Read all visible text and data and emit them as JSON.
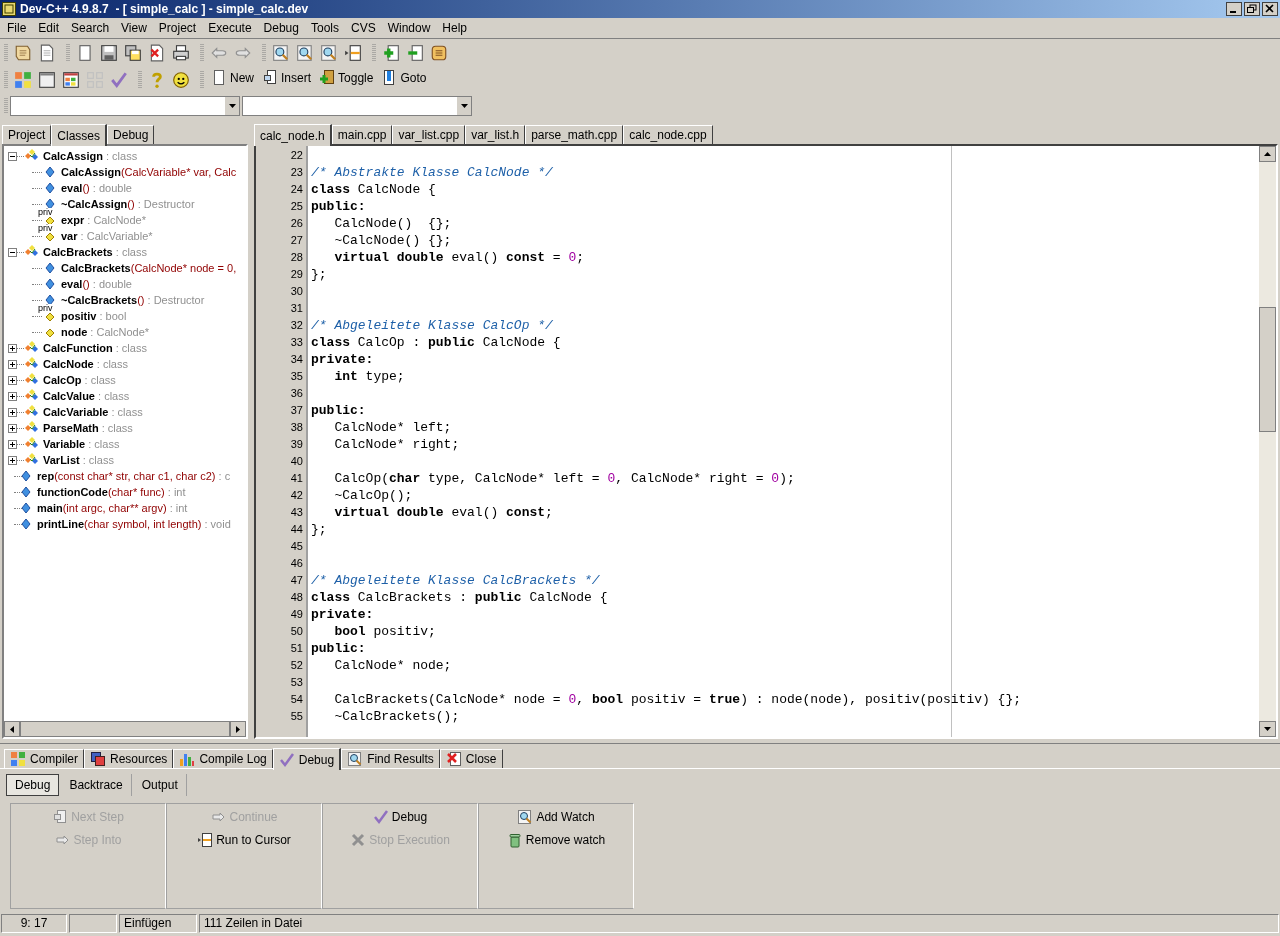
{
  "window": {
    "title": "Dev-C++ 4.9.8.7  - [ simple_calc ] - simple_calc.dev"
  },
  "menu": [
    "File",
    "Edit",
    "Search",
    "View",
    "Project",
    "Execute",
    "Debug",
    "Tools",
    "CVS",
    "Window",
    "Help"
  ],
  "bookmark_buttons": [
    "New",
    "Insert",
    "Toggle",
    "Goto"
  ],
  "left_tabs": [
    {
      "label": "Project",
      "selected": false
    },
    {
      "label": "Classes",
      "selected": true
    },
    {
      "label": "Debug",
      "selected": false
    }
  ],
  "class_tree": [
    {
      "kind": "class",
      "name": "CalcAssign",
      "type": ": class",
      "expanded": true,
      "children": [
        {
          "kind": "method",
          "name": "CalcAssign",
          "params": "(CalcVariable* var, Calc"
        },
        {
          "kind": "method",
          "name": "eval",
          "params": "()",
          "type": ": double"
        },
        {
          "kind": "method",
          "name": "~CalcAssign",
          "params": "()",
          "type": ": Destructor"
        },
        {
          "kind": "variable",
          "badge": "priv",
          "name": "expr",
          "type": ": CalcNode*"
        },
        {
          "kind": "variable",
          "badge": "priv",
          "name": "var",
          "type": ": CalcVariable*"
        }
      ]
    },
    {
      "kind": "class",
      "name": "CalcBrackets",
      "type": ": class",
      "expanded": true,
      "children": [
        {
          "kind": "method",
          "name": "CalcBrackets",
          "params": "(CalcNode* node = 0,"
        },
        {
          "kind": "method",
          "name": "eval",
          "params": "()",
          "type": ": double"
        },
        {
          "kind": "method",
          "name": "~CalcBrackets",
          "params": "()",
          "type": ": Destructor"
        },
        {
          "kind": "variable",
          "badge": "priv",
          "name": "positiv",
          "type": ": bool"
        },
        {
          "kind": "variable",
          "name": "node",
          "type": ": CalcNode*"
        }
      ]
    },
    {
      "kind": "class",
      "name": "CalcFunction",
      "type": ": class",
      "expanded": false
    },
    {
      "kind": "class",
      "name": "CalcNode",
      "type": ": class",
      "expanded": false
    },
    {
      "kind": "class",
      "name": "CalcOp",
      "type": ": class",
      "expanded": false
    },
    {
      "kind": "class",
      "name": "CalcValue",
      "type": ": class",
      "expanded": false
    },
    {
      "kind": "class",
      "name": "CalcVariable",
      "type": ": class",
      "expanded": false
    },
    {
      "kind": "class",
      "name": "ParseMath",
      "type": ": class",
      "expanded": false
    },
    {
      "kind": "class",
      "name": "Variable",
      "type": ": class",
      "expanded": false
    },
    {
      "kind": "class",
      "name": "VarList",
      "type": ": class",
      "expanded": false
    },
    {
      "kind": "function",
      "name": "rep",
      "params": "(const char* str, char c1, char c2)",
      "type": ": c"
    },
    {
      "kind": "function",
      "name": "functionCode",
      "params": "(char* func)",
      "type": ": int"
    },
    {
      "kind": "function",
      "name": "main",
      "params": "(int argc, char** argv)",
      "type": ": int"
    },
    {
      "kind": "function",
      "name": "printLine",
      "params": "(char symbol, int length)",
      "type": ": void"
    }
  ],
  "editor_tabs": [
    {
      "label": "calc_node.h",
      "selected": true
    },
    {
      "label": "main.cpp",
      "selected": false
    },
    {
      "label": "var_list.cpp",
      "selected": false
    },
    {
      "label": "var_list.h",
      "selected": false
    },
    {
      "label": "parse_math.cpp",
      "selected": false
    },
    {
      "label": "calc_node.cpp",
      "selected": false
    }
  ],
  "code_lines": [
    {
      "number": "22"
    },
    {
      "number": "23",
      "tokens": [
        {
          "kind": "comment",
          "text": "/* Abstrakte Klasse CalcNode */"
        }
      ]
    },
    {
      "number": "24",
      "tokens": [
        {
          "kind": "keyword",
          "text": "class"
        },
        {
          "kind": "plain",
          "text": " CalcNode {"
        }
      ]
    },
    {
      "number": "25",
      "tokens": [
        {
          "kind": "keyword",
          "text": "public:"
        }
      ]
    },
    {
      "number": "26",
      "tokens": [
        {
          "kind": "plain",
          "text": "   CalcNode()  {};"
        }
      ]
    },
    {
      "number": "27",
      "tokens": [
        {
          "kind": "plain",
          "text": "   ~CalcNode() {};"
        }
      ]
    },
    {
      "number": "28",
      "tokens": [
        {
          "kind": "keyword",
          "text": "   virtual double"
        },
        {
          "kind": "plain",
          "text": " eval() "
        },
        {
          "kind": "keyword",
          "text": "const"
        },
        {
          "kind": "plain",
          "text": " = "
        },
        {
          "kind": "number",
          "text": "0"
        },
        {
          "kind": "plain",
          "text": ";"
        }
      ]
    },
    {
      "number": "29",
      "tokens": [
        {
          "kind": "plain",
          "text": "};"
        }
      ]
    },
    {
      "number": "30"
    },
    {
      "number": "31"
    },
    {
      "number": "32",
      "tokens": [
        {
          "kind": "comment",
          "text": "/* Abgeleitete Klasse CalcOp */"
        }
      ]
    },
    {
      "number": "33",
      "tokens": [
        {
          "kind": "keyword",
          "text": "class"
        },
        {
          "kind": "plain",
          "text": " CalcOp : "
        },
        {
          "kind": "keyword",
          "text": "public"
        },
        {
          "kind": "plain",
          "text": " CalcNode {"
        }
      ]
    },
    {
      "number": "34",
      "tokens": [
        {
          "kind": "keyword",
          "text": "private:"
        }
      ]
    },
    {
      "number": "35",
      "tokens": [
        {
          "kind": "keyword",
          "text": "   int"
        },
        {
          "kind": "plain",
          "text": " type;"
        }
      ]
    },
    {
      "number": "36"
    },
    {
      "number": "37",
      "tokens": [
        {
          "kind": "keyword",
          "text": "public:"
        }
      ]
    },
    {
      "number": "38",
      "tokens": [
        {
          "kind": "plain",
          "text": "   CalcNode* left;"
        }
      ]
    },
    {
      "number": "39",
      "tokens": [
        {
          "kind": "plain",
          "text": "   CalcNode* right;"
        }
      ]
    },
    {
      "number": "40"
    },
    {
      "number": "41",
      "tokens": [
        {
          "kind": "plain",
          "text": "   CalcOp("
        },
        {
          "kind": "keyword",
          "text": "char"
        },
        {
          "kind": "plain",
          "text": " type, CalcNode* left = "
        },
        {
          "kind": "number",
          "text": "0"
        },
        {
          "kind": "plain",
          "text": ", CalcNode* right = "
        },
        {
          "kind": "number",
          "text": "0"
        },
        {
          "kind": "plain",
          "text": ");"
        }
      ]
    },
    {
      "number": "42",
      "tokens": [
        {
          "kind": "plain",
          "text": "   ~CalcOp();"
        }
      ]
    },
    {
      "number": "43",
      "tokens": [
        {
          "kind": "keyword",
          "text": "   virtual double"
        },
        {
          "kind": "plain",
          "text": " eval() "
        },
        {
          "kind": "keyword",
          "text": "const"
        },
        {
          "kind": "plain",
          "text": ";"
        }
      ]
    },
    {
      "number": "44",
      "tokens": [
        {
          "kind": "plain",
          "text": "};"
        }
      ]
    },
    {
      "number": "45"
    },
    {
      "number": "46"
    },
    {
      "number": "47",
      "tokens": [
        {
          "kind": "comment",
          "text": "/* Abgeleitete Klasse CalcBrackets */"
        }
      ]
    },
    {
      "number": "48",
      "tokens": [
        {
          "kind": "keyword",
          "text": "class"
        },
        {
          "kind": "plain",
          "text": " CalcBrackets : "
        },
        {
          "kind": "keyword",
          "text": "public"
        },
        {
          "kind": "plain",
          "text": " CalcNode {"
        }
      ]
    },
    {
      "number": "49",
      "tokens": [
        {
          "kind": "keyword",
          "text": "private:"
        }
      ]
    },
    {
      "number": "50",
      "tokens": [
        {
          "kind": "keyword",
          "text": "   bool"
        },
        {
          "kind": "plain",
          "text": " positiv;"
        }
      ]
    },
    {
      "number": "51",
      "tokens": [
        {
          "kind": "keyword",
          "text": "public:"
        }
      ]
    },
    {
      "number": "52",
      "tokens": [
        {
          "kind": "plain",
          "text": "   CalcNode* node;"
        }
      ]
    },
    {
      "number": "53"
    },
    {
      "number": "54",
      "tokens": [
        {
          "kind": "plain",
          "text": "   CalcBrackets(CalcNode* node = "
        },
        {
          "kind": "number",
          "text": "0"
        },
        {
          "kind": "plain",
          "text": ", "
        },
        {
          "kind": "keyword",
          "text": "bool"
        },
        {
          "kind": "plain",
          "text": " positiv = "
        },
        {
          "kind": "keyword",
          "text": "true"
        },
        {
          "kind": "plain",
          "text": ") : node(node), positiv(positiv) {};"
        }
      ]
    },
    {
      "number": "55",
      "tokens": [
        {
          "kind": "plain",
          "text": "   ~CalcBrackets();"
        }
      ]
    }
  ],
  "bottom_tabs": [
    {
      "label": "Compiler",
      "selected": false
    },
    {
      "label": "Resources",
      "selected": false
    },
    {
      "label": "Compile Log",
      "selected": false
    },
    {
      "label": "Debug",
      "selected": true
    },
    {
      "label": "Find Results",
      "selected": false
    },
    {
      "label": "Close",
      "selected": false
    }
  ],
  "debug_subtabs": [
    {
      "label": "Debug",
      "selected": true
    },
    {
      "label": "Backtrace",
      "selected": false
    },
    {
      "label": "Output",
      "selected": false
    }
  ],
  "debug_groups": [
    [
      {
        "label": "Next Step",
        "disabled": true
      },
      {
        "label": "Step Into",
        "disabled": true
      }
    ],
    [
      {
        "label": "Continue",
        "disabled": true
      },
      {
        "label": "Run to Cursor",
        "disabled": false
      }
    ],
    [
      {
        "label": "Debug",
        "disabled": false
      },
      {
        "label": "Stop Execution",
        "disabled": true
      }
    ],
    [
      {
        "label": "Add Watch",
        "disabled": false
      },
      {
        "label": "Remove watch",
        "disabled": false
      }
    ]
  ],
  "status_bar": {
    "position": "9: 17",
    "mode": "Einfügen",
    "info": "111 Zeilen in Datei"
  }
}
